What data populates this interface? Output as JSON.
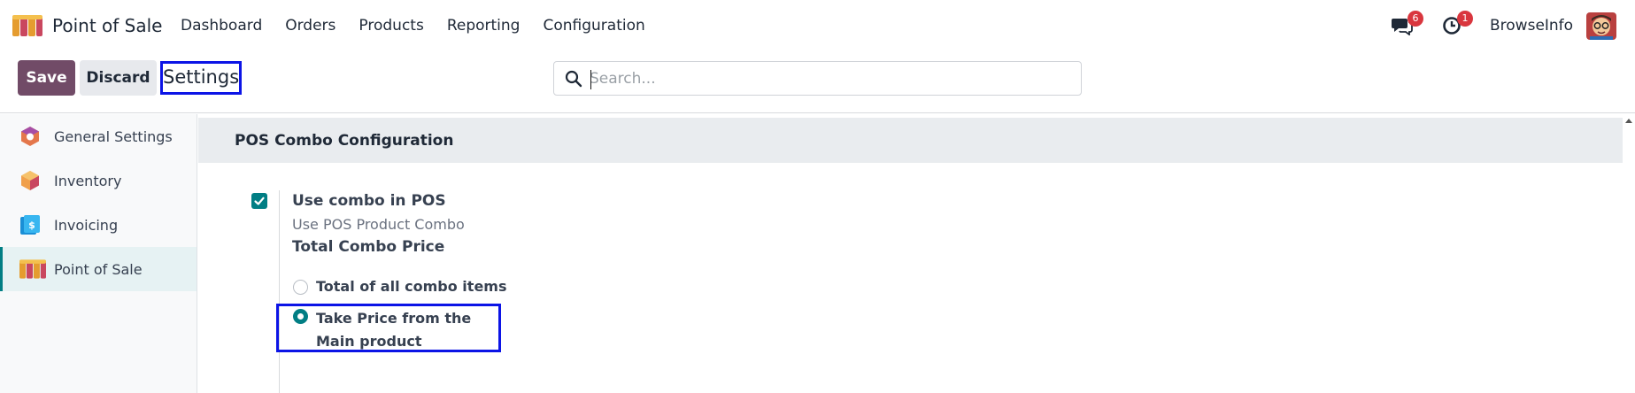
{
  "navbar": {
    "app_name": "Point of Sale",
    "menu": [
      "Dashboard",
      "Orders",
      "Products",
      "Reporting",
      "Configuration"
    ],
    "messages_badge": "6",
    "activities_badge": "1",
    "company": "BrowseInfo"
  },
  "control_panel": {
    "save_label": "Save",
    "discard_label": "Discard",
    "breadcrumb": "Settings",
    "search_placeholder": "Search..."
  },
  "sidebar": {
    "items": [
      {
        "label": "General Settings",
        "icon": "general-settings-icon"
      },
      {
        "label": "Inventory",
        "icon": "inventory-icon"
      },
      {
        "label": "Invoicing",
        "icon": "invoicing-icon"
      },
      {
        "label": "Point of Sale",
        "icon": "point-of-sale-icon",
        "active": true
      }
    ]
  },
  "section": {
    "title": "POS Combo Configuration",
    "setting_title": "Use combo in POS",
    "setting_desc": "Use POS Product Combo",
    "setting_sub": "Total Combo Price",
    "checked": true,
    "radio_options": [
      {
        "label": "Total of all combo items",
        "selected": false
      },
      {
        "label": "Take Price from the Main product",
        "selected": true
      }
    ]
  },
  "colors": {
    "brand": "#714b67",
    "accent": "#017e84",
    "highlight": "#0c14e6",
    "badge": "#d9363e"
  }
}
